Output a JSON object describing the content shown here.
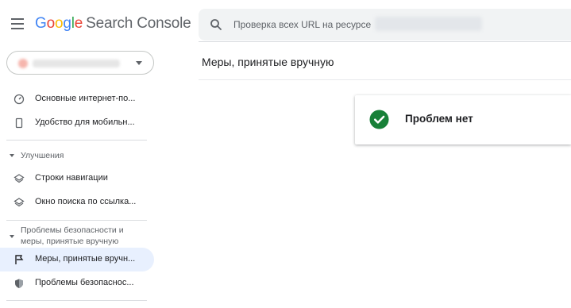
{
  "header": {
    "logo": {
      "g1": "G",
      "g2": "o",
      "g3": "o",
      "g4": "g",
      "g5": "l",
      "g6": "e",
      "product": "Search Console"
    },
    "search_placeholder": "Проверка всех URL на ресурсе"
  },
  "sidebar": {
    "items_top": [
      {
        "label": "Основные интернет-по...",
        "icon": "gauge-icon"
      },
      {
        "label": "Удобство для мобильн...",
        "icon": "phone-icon"
      }
    ],
    "section_improvements": {
      "label": "Улучшения"
    },
    "items_improvements": [
      {
        "label": "Строки навигации",
        "icon": "layers-icon"
      },
      {
        "label": "Окно поиска по ссылка...",
        "icon": "layers-icon"
      }
    ],
    "section_security": {
      "label_line1": "Проблемы безопасности и",
      "label_line2": "меры, принятые вручную"
    },
    "items_security": [
      {
        "label": "Меры, принятые вручн...",
        "icon": "flag-icon",
        "active": true
      },
      {
        "label": "Проблемы безопаснос...",
        "icon": "shield-icon"
      }
    ]
  },
  "main": {
    "title": "Меры, принятые вручную",
    "status_card": {
      "label": "Проблем нет",
      "icon": "check-circle-icon",
      "color": "#188038"
    }
  },
  "colors": {
    "accent": "#1a73e8",
    "active_bg": "#e8f0fe",
    "success": "#188038"
  }
}
